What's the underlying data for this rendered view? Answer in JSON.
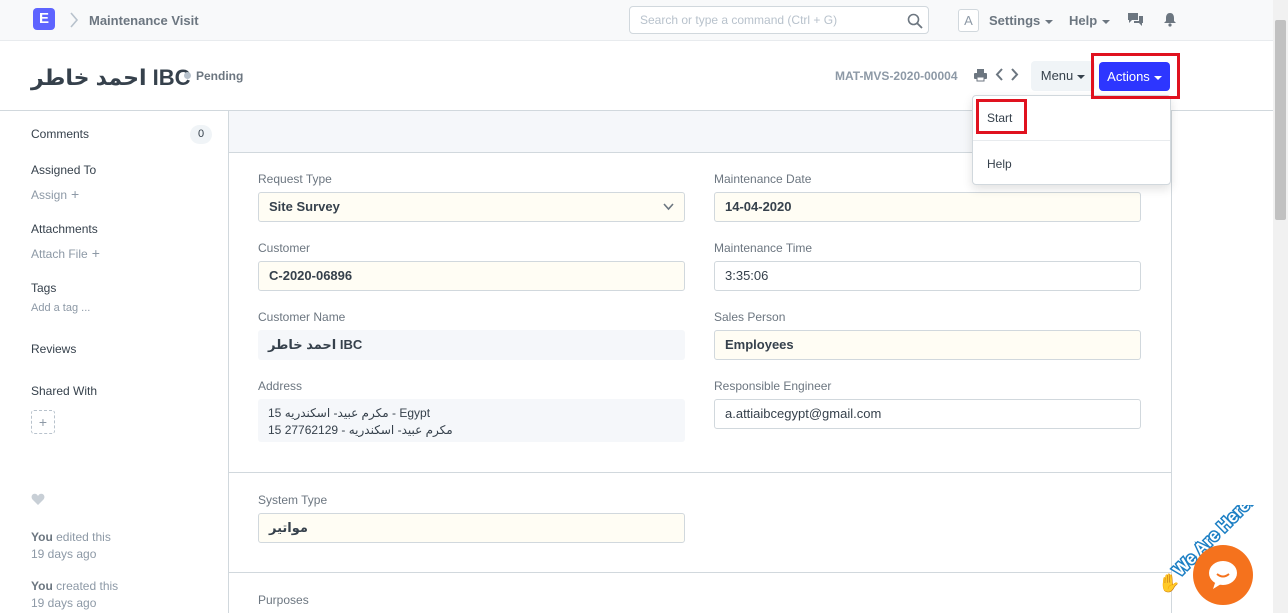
{
  "navbar": {
    "logo": "E",
    "breadcrumb": "Maintenance Visit",
    "search_placeholder": "Search or type a command (Ctrl + G)",
    "avatar": "A",
    "settings_label": "Settings",
    "help_label": "Help"
  },
  "header": {
    "title": "احمد خاطر IBC",
    "status": "Pending",
    "doc_name": "MAT-MVS-2020-00004",
    "menu_label": "Menu",
    "actions_label": "Actions"
  },
  "actions_dropdown": {
    "items": [
      "Start",
      "Help"
    ]
  },
  "sidebar": {
    "comments_label": "Comments",
    "comments_count": "0",
    "assigned_to_label": "Assigned To",
    "assign_label": "Assign",
    "attachments_label": "Attachments",
    "attach_file_label": "Attach File",
    "tags_label": "Tags",
    "add_tag_label": "Add a tag ...",
    "reviews_label": "Reviews",
    "shared_with_label": "Shared With",
    "activity": [
      {
        "user": "You",
        "action": "edited this",
        "when": "19 days ago"
      },
      {
        "user": "You",
        "action": "created this",
        "when": "19 days ago"
      }
    ]
  },
  "form": {
    "request_type": {
      "label": "Request Type",
      "value": "Site Survey"
    },
    "customer": {
      "label": "Customer",
      "value": "C-2020-06896"
    },
    "customer_name": {
      "label": "Customer Name",
      "value": "احمد خاطر IBC"
    },
    "address": {
      "label": "Address",
      "line1": "15 مكرم عبيد- اسكندريه - Egypt",
      "line2": "15 مكرم عبيد- اسكندريه - 27762129"
    },
    "maintenance_date": {
      "label": "Maintenance Date",
      "value": "14-04-2020"
    },
    "maintenance_time": {
      "label": "Maintenance Time",
      "value": "3:35:06"
    },
    "sales_person": {
      "label": "Sales Person",
      "value": "Employees"
    },
    "responsible_engineer": {
      "label": "Responsible Engineer",
      "value": "a.attiaibcegypt@gmail.com"
    },
    "system_type": {
      "label": "System Type",
      "value": "مواتير"
    },
    "purposes_label": "Purposes"
  },
  "chat_widget": {
    "text": "We Are Here!"
  },
  "colors": {
    "accent": "#5e64ff",
    "primary_button": "#2d36ff",
    "highlight": "#e0121f",
    "chat": "#f5721d"
  }
}
